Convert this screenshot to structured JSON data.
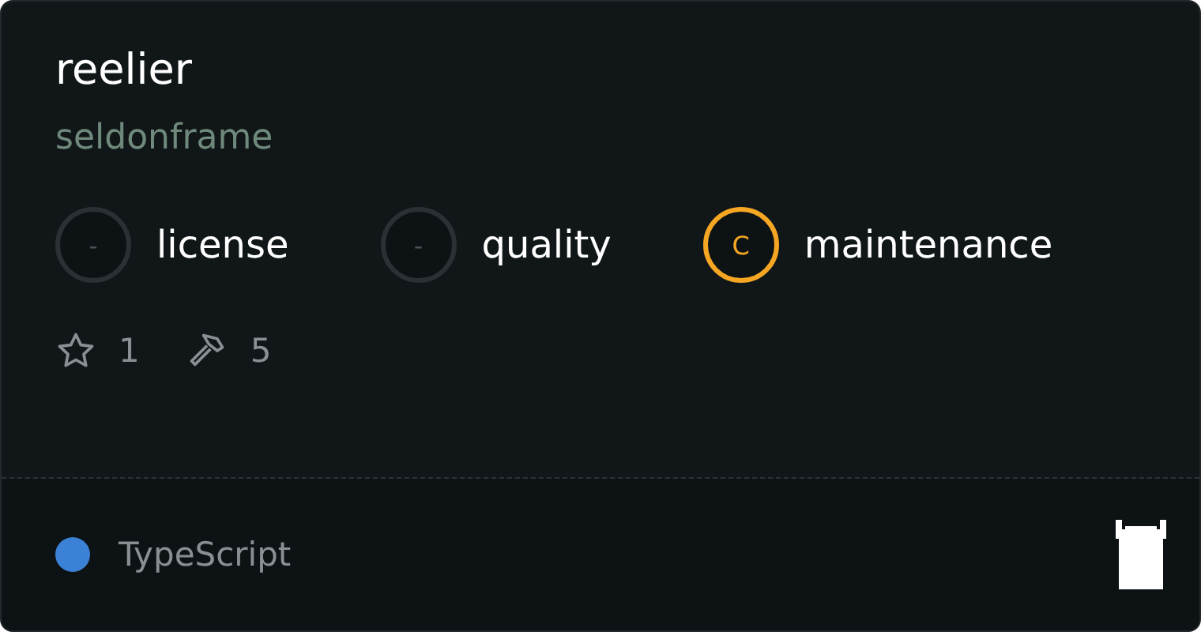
{
  "package": {
    "name": "reelier",
    "owner": "seldonframe"
  },
  "scores": [
    {
      "grade": "-",
      "label": "license",
      "color": "#2a3033"
    },
    {
      "grade": "-",
      "label": "quality",
      "color": "#2a3033"
    },
    {
      "grade": "C",
      "label": "maintenance",
      "color": "#f5a623"
    }
  ],
  "stats": {
    "stars": "1",
    "forks": "5"
  },
  "language": {
    "name": "TypeScript",
    "color": "#3b82d6"
  }
}
